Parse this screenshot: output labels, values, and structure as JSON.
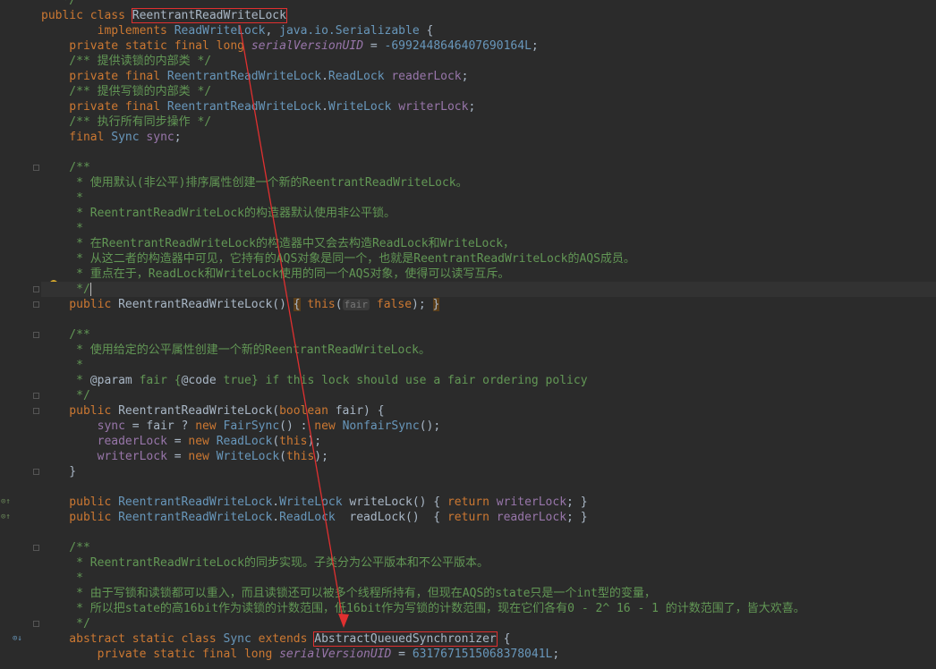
{
  "editor": {
    "lines": [
      {
        "text": "   */"
      },
      {
        "text": "public class ReentrantReadWriteLock"
      },
      {
        "text": "        implements ReadWriteLock, java.io.Serializable {"
      },
      {
        "text": "    private static final long serialVersionUID = -6992448646407690164L;"
      },
      {
        "text": "    /** 提供读锁的内部类 */"
      },
      {
        "text": "    private final ReentrantReadWriteLock.ReadLock readerLock;"
      },
      {
        "text": "    /** 提供写锁的内部类 */"
      },
      {
        "text": "    private final ReentrantReadWriteLock.WriteLock writerLock;"
      },
      {
        "text": "    /** 执行所有同步操作 */"
      },
      {
        "text": "    final Sync sync;"
      },
      {
        "text": ""
      },
      {
        "text": "    /**"
      },
      {
        "text": "     * 使用默认(非公平)排序属性创建一个新的ReentrantReadWriteLock。"
      },
      {
        "text": "     *"
      },
      {
        "text": "     * ReentrantReadWriteLock的构造器默认使用非公平锁。"
      },
      {
        "text": "     *"
      },
      {
        "text": "     * 在ReentrantReadWriteLock的构造器中又会去构造ReadLock和WriteLock，"
      },
      {
        "text": "     * 从这二者的构造器中可见，它持有的AQS对象是同一个，也就是ReentrantReadWriteLock的AQS成员。"
      },
      {
        "text": "     * 重点在于，ReadLock和WriteLock使用的同一个AQS对象，使得可以读写互斥。"
      },
      {
        "text": "     */"
      },
      {
        "text": "    public ReentrantReadWriteLock() { this(fair: false); }"
      },
      {
        "text": ""
      },
      {
        "text": "    /**"
      },
      {
        "text": "     * 使用给定的公平属性创建一个新的ReentrantReadWriteLock。"
      },
      {
        "text": "     *"
      },
      {
        "text": "     * @param fair {@code true} if this lock should use a fair ordering policy"
      },
      {
        "text": "     */"
      },
      {
        "text": "    public ReentrantReadWriteLock(boolean fair) {"
      },
      {
        "text": "        sync = fair ? new FairSync() : new NonfairSync();"
      },
      {
        "text": "        readerLock = new ReadLock(this);"
      },
      {
        "text": "        writerLock = new WriteLock(this);"
      },
      {
        "text": "    }"
      },
      {
        "text": ""
      },
      {
        "text": "    public ReentrantReadWriteLock.WriteLock writeLock() { return writerLock; }"
      },
      {
        "text": "    public ReentrantReadWriteLock.ReadLock  readLock()  { return readerLock; }"
      },
      {
        "text": ""
      },
      {
        "text": "    /**"
      },
      {
        "text": "     * ReentrantReadWriteLock的同步实现。子类分为公平版本和不公平版本。"
      },
      {
        "text": "     *"
      },
      {
        "text": "     * 由于写锁和读锁都可以重入，而且读锁还可以被多个线程所持有，但现在AQS的state只是一个int型的变量，"
      },
      {
        "text": "     * 所以把state的高16bit作为读锁的计数范围，低16bit作为写锁的计数范围，现在它们各有0 - 2^ 16 - 1 的计数范围了，皆大欢喜。"
      },
      {
        "text": "     */"
      },
      {
        "text": "    abstract static class Sync extends AbstractQueuedSynchronizer {"
      },
      {
        "text": "        private static final long serialVersionUID = 6317671515068378041L;"
      }
    ],
    "highlights": {
      "class_name": "ReentrantReadWriteLock",
      "super_class": "AbstractQueuedSynchronizer"
    },
    "param_hint": "fair"
  },
  "colors": {
    "background": "#2b2b2b",
    "keyword": "#cc7832",
    "comment": "#629755",
    "field": "#9876aa",
    "annotation_box": "#e03030"
  }
}
